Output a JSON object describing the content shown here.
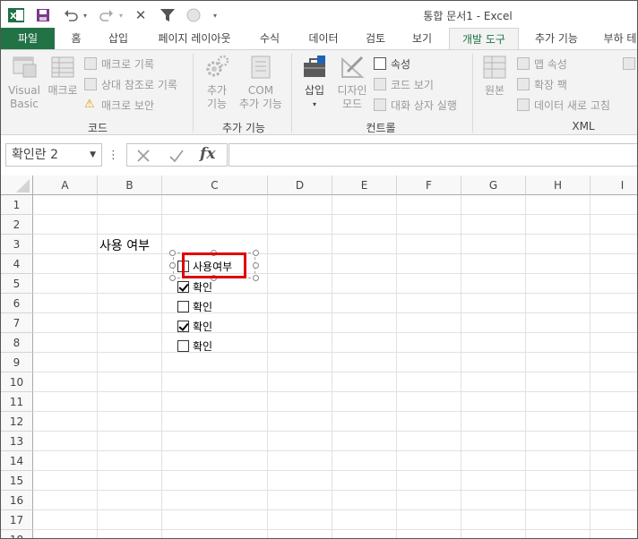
{
  "titlebar": {
    "doc_title": "통합 문서1 - Excel",
    "quick_access": [
      "excel-logo",
      "save",
      "undo",
      "redo",
      "delete",
      "filter",
      "circle",
      "customize"
    ]
  },
  "tabs": [
    "파일",
    "홈",
    "삽입",
    "페이지 레이아웃",
    "수식",
    "데이터",
    "검토",
    "보기",
    "개발 도구",
    "추가 기능",
    "부하 테"
  ],
  "active_tab": "개발 도구",
  "ribbon": {
    "code": {
      "visual_basic": "Visual\nBasic",
      "macro": "매크로",
      "record_macro": "매크로 기록",
      "relative_ref": "상대 참조로 기록",
      "macro_security": "매크로 보안",
      "label": "코드"
    },
    "addins": {
      "addins_btn": "추가\n기능",
      "com_addins": "COM\n추가 기능",
      "label": "추가 기능"
    },
    "controls": {
      "insert": "삽입",
      "design_mode": "디자인\n모드",
      "properties": "속성",
      "view_code": "코드 보기",
      "run_dialog": "대화 상자 실행",
      "label": "컨트롤"
    },
    "xml": {
      "source": "원본",
      "map_properties": "맵 속성",
      "expansion_packs": "확장 팩",
      "refresh_data": "데이터 새로 고침",
      "label": "XML"
    }
  },
  "formula_bar": {
    "name_box": "확인란 2",
    "fx": "fx",
    "content": ""
  },
  "grid": {
    "columns": [
      "A",
      "B",
      "C",
      "D",
      "E",
      "F",
      "G",
      "H",
      "I"
    ],
    "rows": [
      "1",
      "2",
      "3",
      "4",
      "5",
      "6",
      "7",
      "8",
      "9",
      "10",
      "11",
      "12",
      "13",
      "14",
      "15",
      "16",
      "17",
      "18"
    ],
    "b3_text": "사용 여부",
    "checkboxes": [
      {
        "label": "사용여부",
        "checked": false
      },
      {
        "label": "확인",
        "checked": true
      },
      {
        "label": "확인",
        "checked": false
      },
      {
        "label": "확인",
        "checked": true
      },
      {
        "label": "확인",
        "checked": false
      }
    ]
  },
  "colors": {
    "accent": "#217346",
    "highlight": "#e00000"
  }
}
